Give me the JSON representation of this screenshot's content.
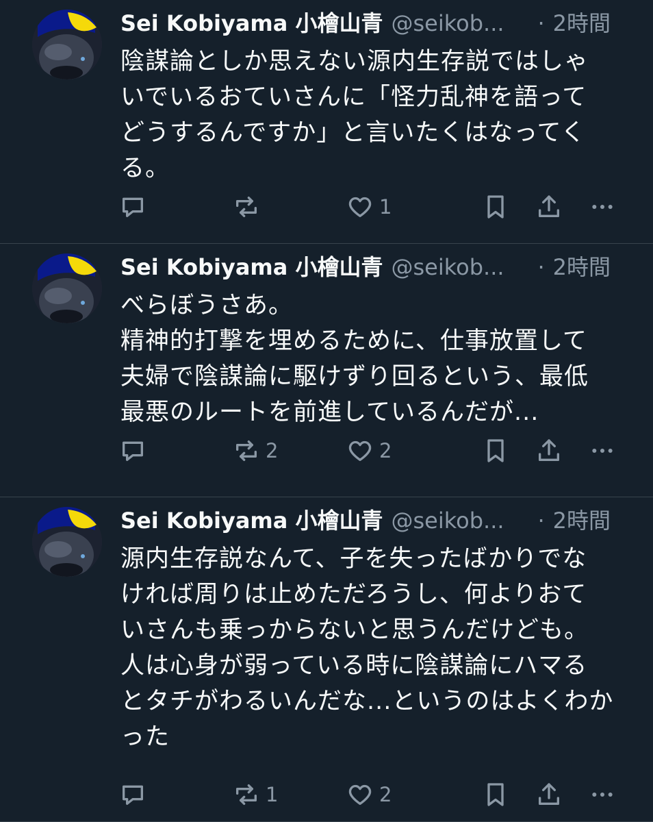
{
  "tweets": [
    {
      "display_name": "Sei Kobiyama 小檜山青",
      "handle": "@seikob...",
      "dot": "·",
      "time": "2時間",
      "lines": [
        "陰謀論としか思えない源内生存説ではしゃ",
        "いでいるおていさんに「怪力乱神を語って",
        "どうするんですか」と言いたくはなってく",
        "る。"
      ],
      "reply_count": "",
      "retweet_count": "",
      "like_count": "1"
    },
    {
      "display_name": "Sei Kobiyama 小檜山青",
      "handle": "@seikob...",
      "dot": "·",
      "time": "2時間",
      "lines": [
        "べらぼうさあ。",
        "精神的打撃を埋めるために、仕事放置して",
        "夫婦で陰謀論に駆けずり回るという、最低",
        "最悪のルートを前進しているんだが..."
      ],
      "reply_count": "",
      "retweet_count": "2",
      "like_count": "2"
    },
    {
      "display_name": "Sei Kobiyama 小檜山青",
      "handle": "@seikob...",
      "dot": "·",
      "time": "2時間",
      "lines": [
        "源内生存説なんて、子を失ったばかりでな",
        "ければ周りは止めただろうし、何よりおて",
        "いさんも乗っからないと思うんだけども。",
        "人は心身が弱っている時に陰謀論にハマる",
        "とタチがわるいんだな...というのはよくわか",
        "った"
      ],
      "reply_count": "",
      "retweet_count": "1",
      "like_count": "2"
    }
  ],
  "icons": {
    "reply": "reply-icon",
    "retweet": "retweet-icon",
    "like": "heart-icon",
    "bookmark": "bookmark-icon",
    "share": "share-icon",
    "more": "more-icon"
  },
  "colors": {
    "background": "#15202b",
    "text_primary": "#f7f9f9",
    "text_secondary": "#8b98a5",
    "divider": "#38444d",
    "avatar_accent": "#f5d90a"
  }
}
